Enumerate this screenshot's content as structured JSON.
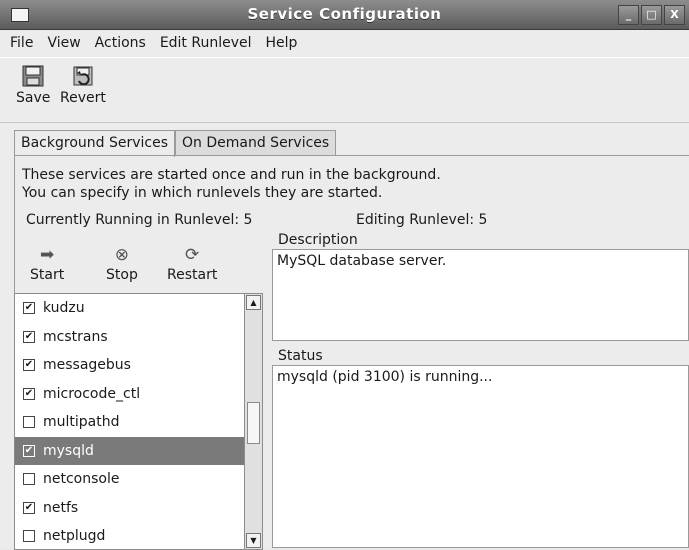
{
  "window": {
    "title": "Service Configuration"
  },
  "menu": [
    "File",
    "View",
    "Actions",
    "Edit Runlevel",
    "Help"
  ],
  "toolbar": {
    "save_label": "Save",
    "revert_label": "Revert"
  },
  "tabs": [
    {
      "label": "Background Services",
      "accel": "B",
      "active": true
    },
    {
      "label": "On Demand Services",
      "accel": "O",
      "active": false
    }
  ],
  "intro": {
    "line1": "These services are started once and run in the background.",
    "line2": "You can specify in which runlevels they are started."
  },
  "runlevel": {
    "running": "Currently Running in Runlevel: 5",
    "editing": "Editing Runlevel: 5"
  },
  "controls": {
    "start": "Start",
    "stop": "Stop",
    "restart": "Restart"
  },
  "services": [
    {
      "name": "kudzu",
      "checked": true,
      "selected": false
    },
    {
      "name": "mcstrans",
      "checked": true,
      "selected": false
    },
    {
      "name": "messagebus",
      "checked": true,
      "selected": false
    },
    {
      "name": "microcode_ctl",
      "checked": true,
      "selected": false
    },
    {
      "name": "multipathd",
      "checked": false,
      "selected": false
    },
    {
      "name": "mysqld",
      "checked": true,
      "selected": true
    },
    {
      "name": "netconsole",
      "checked": false,
      "selected": false
    },
    {
      "name": "netfs",
      "checked": true,
      "selected": false
    },
    {
      "name": "netplugd",
      "checked": false,
      "selected": false
    }
  ],
  "description": {
    "label": "Description",
    "text": "MySQL database server."
  },
  "status": {
    "label": "Status",
    "text": "mysqld (pid 3100) is running..."
  }
}
